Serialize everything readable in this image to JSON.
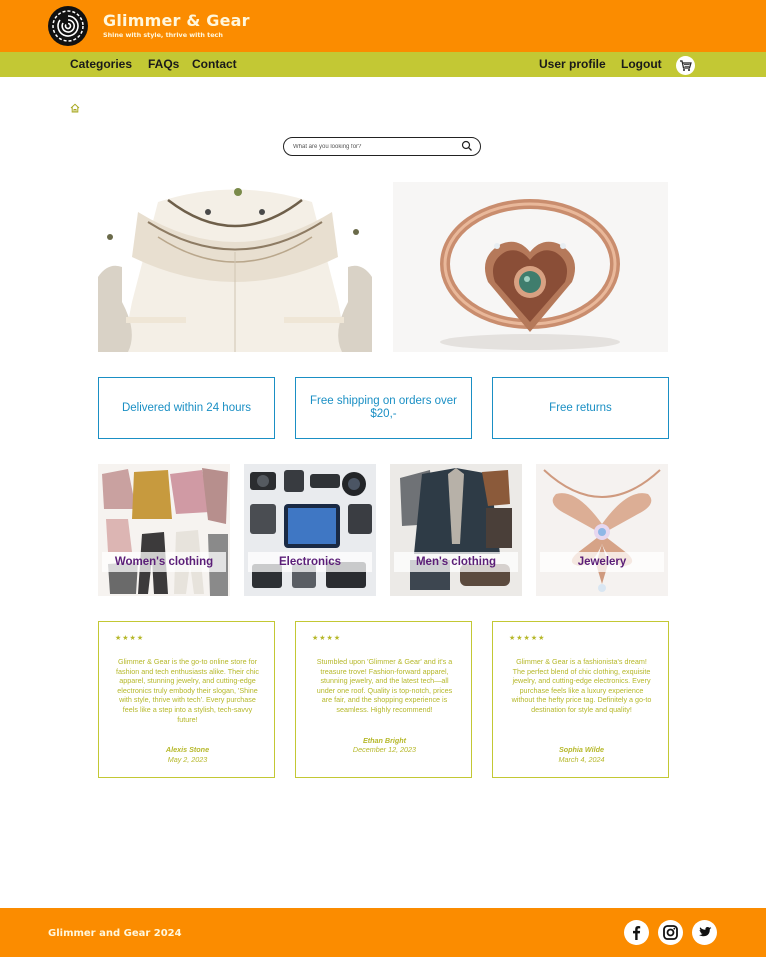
{
  "header": {
    "brand_name": "Glimmer & Gear",
    "slogan": "Shine with style, thrive with tech"
  },
  "nav": {
    "left": [
      "Categories",
      "FAQs",
      "Contact"
    ],
    "right": [
      "User profile",
      "Logout"
    ],
    "cart_icon": "cart-icon"
  },
  "breadcrumb": {
    "icon": "home-icon"
  },
  "search": {
    "placeholder": "What are you looking for?",
    "value": "",
    "icon": "search-icon"
  },
  "features": [
    "Delivered within 24 hours",
    "Free shipping on orders over $20,-",
    "Free returns"
  ],
  "categories": [
    "Women's clothing",
    "Electronics",
    "Men's clothing",
    "Jewelery"
  ],
  "reviews": [
    {
      "stars": 4,
      "text": "Glimmer & Gear is the go-to online store for fashion and tech enthusiasts alike. Their chic apparel, stunning jewelry, and cutting-edge electronics truly embody their slogan, 'Shine with style, thrive with tech'. Every purchase feels like a step into a stylish, tech-savvy future!",
      "author": "Alexis Stone",
      "date": "May 2, 2023"
    },
    {
      "stars": 4,
      "text": "Stumbled upon 'Glimmer & Gear' and it's a treasure trove! Fashion-forward apparel, stunning jewelry, and the latest tech—all under one roof. Quality is top-notch, prices are fair, and the shopping experience is seamless. Highly recommend!",
      "author": "Ethan Bright",
      "date": "December 12, 2023"
    },
    {
      "stars": 5,
      "text": "Glimmer & Gear is a fashionista's dream! The perfect blend of chic clothing, exquisite jewelry, and cutting-edge electronics. Every purchase feels like a luxury experience without the hefty price tag. Definitely a go-to destination for style and quality!",
      "author": "Sophia Wilde",
      "date": "March 4, 2024"
    }
  ],
  "footer": {
    "copyright": "Glimmer and Gear 2024",
    "social_icons": [
      "facebook-icon",
      "instagram-icon",
      "twitter-icon"
    ]
  },
  "colors": {
    "header": "#fb8c00",
    "nav": "#c3c834",
    "feature_border": "#1a8fc4",
    "review_accent": "#b6b82a",
    "category_label": "#5b1e78"
  }
}
